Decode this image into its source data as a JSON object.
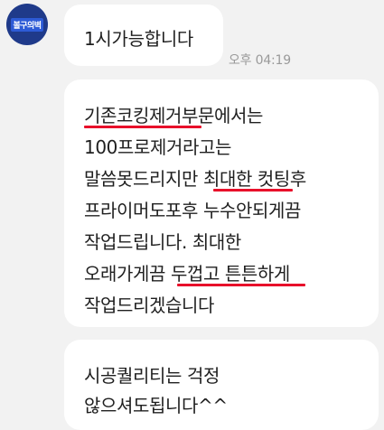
{
  "avatar": {
    "label": "볼구의벽"
  },
  "messages": [
    {
      "text": "1시가능합니다",
      "time": "오후 04:19"
    },
    {
      "lines": [
        "기존코킹제거부문에서는",
        "100프로제거라고는",
        "말씀못드리지만 최대한 컷팅후",
        "프라이머도포후 누수안되게끔",
        "작업드립니다. 최대한",
        "오래가게끔 두껍고 튼튼하게",
        "작업드리겠습니다"
      ]
    },
    {
      "lines": [
        "시공퀄리티는 걱정",
        "않으셔도됩니다^^"
      ]
    }
  ],
  "colors": {
    "background": "#f2f2f2",
    "bubble": "#ffffff",
    "underline": "#e8102a",
    "avatar": "#1f3a8a"
  }
}
